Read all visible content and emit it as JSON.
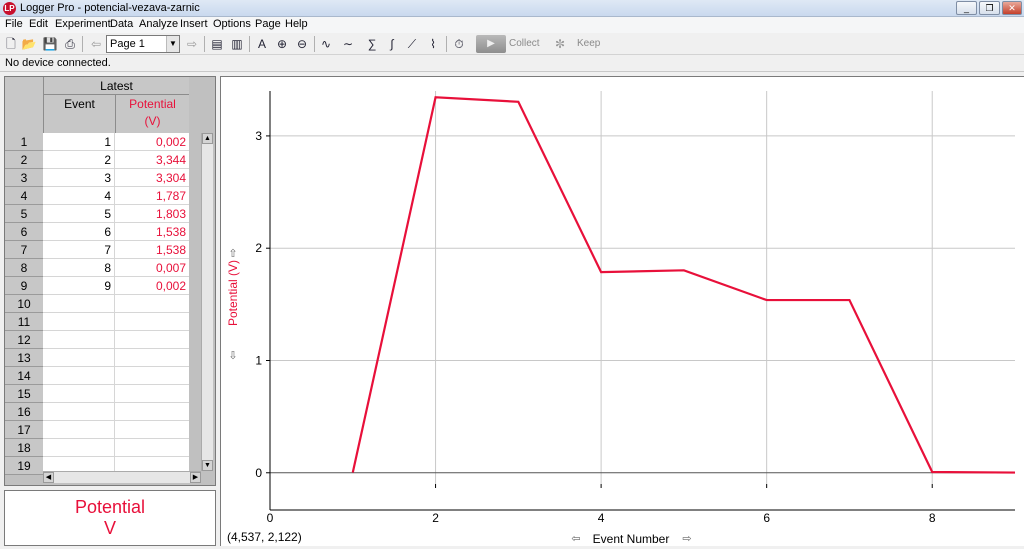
{
  "window": {
    "logo_text": "LP",
    "title": "Logger Pro - potencial-vezava-zarnic",
    "minimize_glyph": "_",
    "restore_glyph": "❐",
    "close_glyph": "✕"
  },
  "menu": [
    "File",
    "Edit",
    "Experiment",
    "Data",
    "Analyze",
    "Insert",
    "Options",
    "Page",
    "Help"
  ],
  "toolbar": {
    "page_select": "Page 1",
    "collect_label": "Collect",
    "keep_label": "Keep"
  },
  "status": "No device connected.",
  "table": {
    "group_header": "Latest",
    "col_event": "Event",
    "col_potential_name": "Potential",
    "col_potential_unit": "(V)",
    "rows": [
      {
        "idx": "1",
        "event": "1",
        "potential": "0,002"
      },
      {
        "idx": "2",
        "event": "2",
        "potential": "3,344"
      },
      {
        "idx": "3",
        "event": "3",
        "potential": "3,304"
      },
      {
        "idx": "4",
        "event": "4",
        "potential": "1,787"
      },
      {
        "idx": "5",
        "event": "5",
        "potential": "1,803"
      },
      {
        "idx": "6",
        "event": "6",
        "potential": "1,538"
      },
      {
        "idx": "7",
        "event": "7",
        "potential": "1,538"
      },
      {
        "idx": "8",
        "event": "8",
        "potential": "0,007"
      },
      {
        "idx": "9",
        "event": "9",
        "potential": "0,002"
      },
      {
        "idx": "10",
        "event": "",
        "potential": ""
      },
      {
        "idx": "11",
        "event": "",
        "potential": ""
      },
      {
        "idx": "12",
        "event": "",
        "potential": ""
      },
      {
        "idx": "13",
        "event": "",
        "potential": ""
      },
      {
        "idx": "14",
        "event": "",
        "potential": ""
      },
      {
        "idx": "15",
        "event": "",
        "potential": ""
      },
      {
        "idx": "16",
        "event": "",
        "potential": ""
      },
      {
        "idx": "17",
        "event": "",
        "potential": ""
      },
      {
        "idx": "18",
        "event": "",
        "potential": ""
      },
      {
        "idx": "19",
        "event": "",
        "potential": ""
      }
    ]
  },
  "meter": {
    "name": "Potential",
    "unit": "V"
  },
  "graph": {
    "coordinate_readout": "(4,537, 2,122)",
    "series_color": "#e8103a",
    "xlabel_arrow_left": "⇦",
    "xlabel_arrow_right": "⇨",
    "ylabel_arrow_up": "⇧",
    "ylabel_arrow_down": "⇩"
  },
  "chart_data": {
    "type": "line",
    "xlabel": "Event Number",
    "ylabel": "Potential (V)",
    "xlim": [
      0,
      9
    ],
    "ylim": [
      -0.1,
      3.4
    ],
    "x_ticks": [
      "0",
      "2",
      "4",
      "6",
      "8"
    ],
    "y_ticks": [
      "0",
      "1",
      "2",
      "3"
    ],
    "grid": true,
    "series": [
      {
        "name": "Potential",
        "x": [
          1,
          2,
          3,
          4,
          5,
          6,
          7,
          8,
          9
        ],
        "y": [
          0.002,
          3.344,
          3.304,
          1.787,
          1.803,
          1.538,
          1.538,
          0.007,
          0.002
        ]
      }
    ]
  }
}
